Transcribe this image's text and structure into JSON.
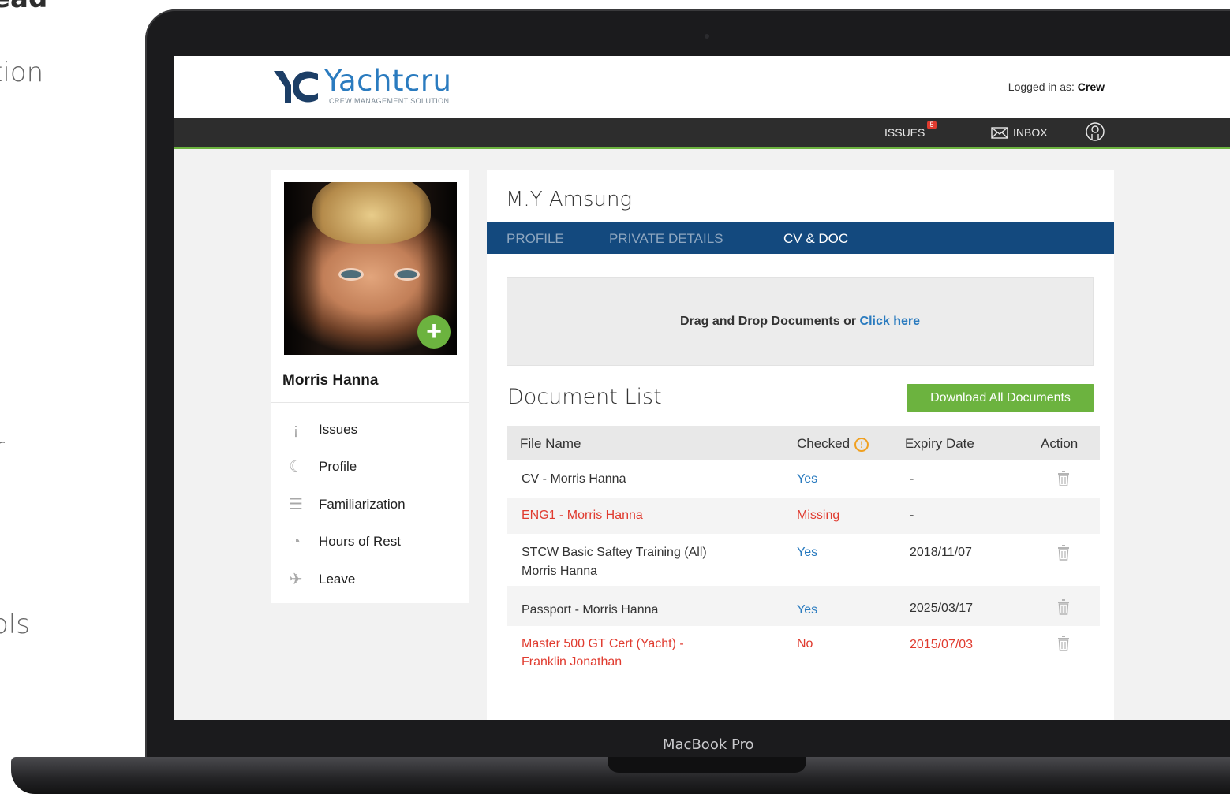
{
  "side_text": {
    "heading": "ead",
    "line1": "tion",
    "line2": "r",
    "line3": "ols"
  },
  "device": {
    "label": "MacBook Pro"
  },
  "app": {
    "logo_name": "Yachtcru",
    "logo_tagline": "CREW MANAGEMENT SOLUTION",
    "logged_in_prefix": "Logged in as:",
    "logged_in_user": "Crew"
  },
  "nav": {
    "issues_label": "ISSUES",
    "issues_count": "5",
    "inbox_label": "INBOX"
  },
  "profile": {
    "name": "Morris Hanna",
    "menu": [
      {
        "label": "Issues",
        "icon": "exclamation-icon"
      },
      {
        "label": "Profile",
        "icon": "user-outline-icon"
      },
      {
        "label": "Familiarization",
        "icon": "list-icon"
      },
      {
        "label": "Hours of Rest",
        "icon": "gauge-icon"
      },
      {
        "label": "Leave",
        "icon": "plane-icon"
      }
    ]
  },
  "main": {
    "vessel": "M.Y Amsung",
    "tabs": [
      "PROFILE",
      "PRIVATE DETAILS",
      "CV & DOC"
    ],
    "active_tab": "CV & DOC",
    "dropzone_text": "Drag and Drop Documents or",
    "dropzone_link": "Click here",
    "doc_list_title": "Document List",
    "download_button": "Download All Documents",
    "table": {
      "headers": [
        "File Name",
        "Checked",
        "Expiry Date",
        "Action"
      ],
      "rows": [
        {
          "file_line1": "CV -  Morris Hanna",
          "file_line2": "",
          "checked": "Yes",
          "expiry": "-",
          "status": "ok"
        },
        {
          "file_line1": "ENG1 - Morris Hanna",
          "file_line2": "",
          "checked": "Missing",
          "expiry": "-",
          "status": "error"
        },
        {
          "file_line1": "STCW Basic Saftey Training (All)",
          "file_line2": "Morris Hanna",
          "checked": "Yes",
          "expiry": "2018/11/07",
          "status": "ok"
        },
        {
          "file_line1": "Passport - Morris Hanna",
          "file_line2": "",
          "checked": "Yes",
          "expiry": "2025/03/17",
          "status": "ok"
        },
        {
          "file_line1": "Master 500 GT Cert (Yacht) -",
          "file_line2": "Franklin Jonathan",
          "checked": "No",
          "expiry": "2015/07/03",
          "status": "error"
        }
      ]
    }
  },
  "colors": {
    "accent_green": "#6cb33f",
    "tab_blue": "#13497e",
    "link_blue": "#2a7bbf",
    "error_red": "#e03b2f"
  }
}
